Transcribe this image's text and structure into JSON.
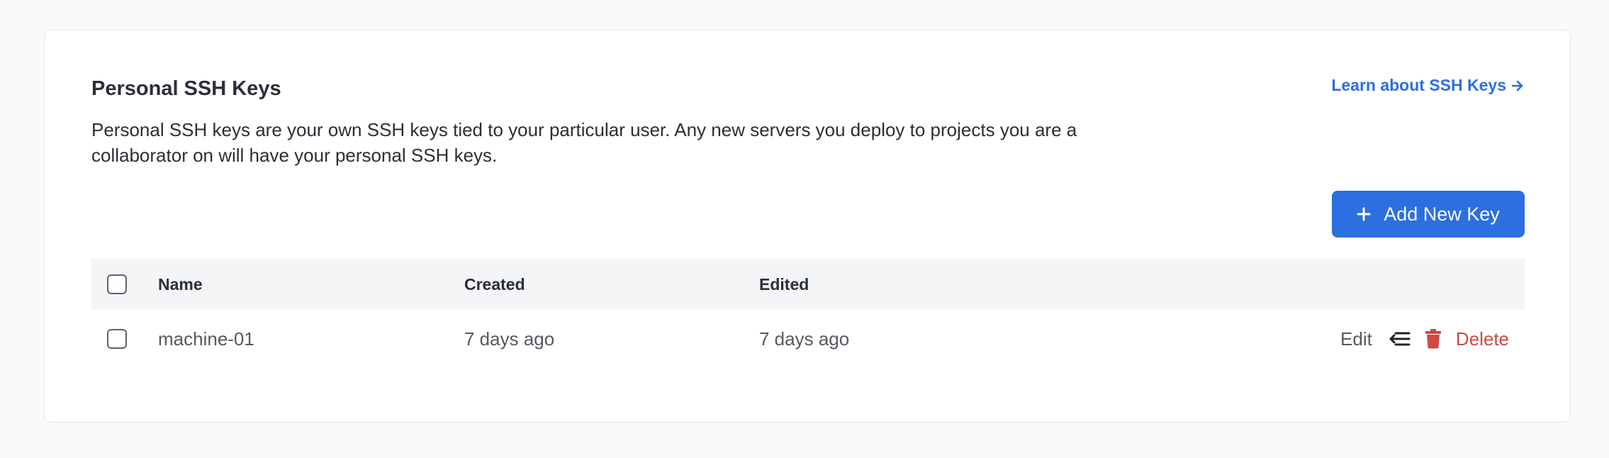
{
  "section": {
    "title": "Personal SSH Keys",
    "description": "Personal SSH keys are your own SSH keys tied to your particular user. Any new servers you deploy to projects you are a collaborator on will have your personal SSH keys.",
    "learn_link": "Learn about SSH Keys",
    "learn_icon": "arrow-right-icon",
    "add_button": "Add New Key",
    "add_icon": "plus-icon"
  },
  "table": {
    "columns": [
      "Name",
      "Created",
      "Edited"
    ],
    "rows": [
      {
        "name": "machine-01",
        "created": "7 days ago",
        "edited": "7 days ago",
        "edit_label": "Edit",
        "delete_label": "Delete"
      }
    ]
  },
  "colors": {
    "accent": "#2c6fe0",
    "danger": "#cc4a42",
    "header_bg": "#f4f5f7"
  }
}
